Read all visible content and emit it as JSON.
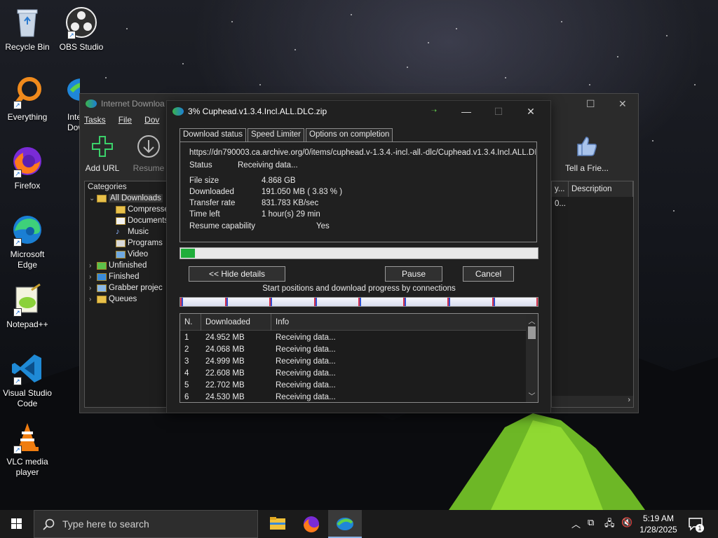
{
  "desktop": {
    "icons": [
      {
        "label": "Recycle Bin"
      },
      {
        "label": "OBS Studio"
      },
      {
        "label": "Everything"
      },
      {
        "label": "Inte\nDow"
      },
      {
        "label": "Firefox"
      },
      {
        "label": "Microsoft Edge"
      },
      {
        "label": "Notepad++"
      },
      {
        "label": "Visual Studio Code"
      },
      {
        "label": "VLC media player"
      }
    ]
  },
  "idm_main": {
    "title": "Internet Downloa",
    "menu": [
      "Tasks",
      "File",
      "Dov"
    ],
    "toolbar": {
      "add_url": "Add URL",
      "resume": "Resume",
      "tell_friend": "Tell a Frie..."
    },
    "categories_header": "Categories",
    "tree": [
      {
        "label": "All Downloads",
        "level": 0
      },
      {
        "label": "Compresse",
        "level": 1
      },
      {
        "label": "Documents",
        "level": 1
      },
      {
        "label": "Music",
        "level": 1
      },
      {
        "label": "Programs",
        "level": 1
      },
      {
        "label": "Video",
        "level": 1
      },
      {
        "label": "Unfinished",
        "level": 0
      },
      {
        "label": "Finished",
        "level": 0
      },
      {
        "label": "Grabber projec",
        "level": 0
      },
      {
        "label": "Queues",
        "level": 0
      }
    ],
    "list_columns": {
      "col_a": "y...",
      "description": "Description"
    },
    "list_row_cell": "0..."
  },
  "dialog": {
    "title": "3% Cuphead.v1.3.4.Incl.ALL.DLC.zip",
    "tabs": [
      "Download status",
      "Speed Limiter",
      "Options on completion"
    ],
    "url": "https://dn790003.ca.archive.org/0/items/cuphead.v-1.3.4.-incl.-all.-dlc/Cuphead.v1.3.4.Incl.ALL.DI",
    "status_label": "Status",
    "status_value": "Receiving data...",
    "file_size_label": "File size",
    "file_size_value": "4.868  GB",
    "downloaded_label": "Downloaded",
    "downloaded_value": "191.050  MB  ( 3.83 % )",
    "transfer_label": "Transfer rate",
    "transfer_value": "831.783  KB/sec",
    "time_left_label": "Time left",
    "time_left_value": "1 hour(s) 29 min",
    "resume_label": "Resume capability",
    "resume_value": "Yes",
    "progress_percent": 3.83,
    "buttons": {
      "hide_details": "<< Hide details",
      "pause": "Pause",
      "cancel": "Cancel"
    },
    "connections_caption": "Start positions and download progress by connections",
    "connection_segments": 8,
    "table_headers": {
      "n": "N.",
      "downloaded": "Downloaded",
      "info": "Info"
    },
    "connections": [
      {
        "n": "1",
        "downloaded": "24.952  MB",
        "info": "Receiving data..."
      },
      {
        "n": "2",
        "downloaded": "24.068  MB",
        "info": "Receiving data..."
      },
      {
        "n": "3",
        "downloaded": "24.999  MB",
        "info": "Receiving data..."
      },
      {
        "n": "4",
        "downloaded": "22.608  MB",
        "info": "Receiving data..."
      },
      {
        "n": "5",
        "downloaded": "22.702  MB",
        "info": "Receiving data..."
      },
      {
        "n": "6",
        "downloaded": "24.530  MB",
        "info": "Receiving data..."
      }
    ]
  },
  "taskbar": {
    "search_placeholder": "Type here to search",
    "time": "5:19 AM",
    "date": "1/28/2025",
    "notification_count": "1"
  }
}
